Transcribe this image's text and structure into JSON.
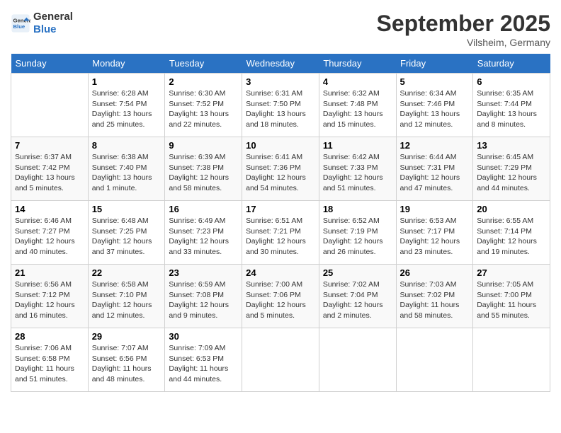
{
  "header": {
    "logo_line1": "General",
    "logo_line2": "Blue",
    "month_title": "September 2025",
    "location": "Vilsheim, Germany"
  },
  "days_of_week": [
    "Sunday",
    "Monday",
    "Tuesday",
    "Wednesday",
    "Thursday",
    "Friday",
    "Saturday"
  ],
  "weeks": [
    [
      {
        "day": "",
        "info": ""
      },
      {
        "day": "1",
        "info": "Sunrise: 6:28 AM\nSunset: 7:54 PM\nDaylight: 13 hours and 25 minutes."
      },
      {
        "day": "2",
        "info": "Sunrise: 6:30 AM\nSunset: 7:52 PM\nDaylight: 13 hours and 22 minutes."
      },
      {
        "day": "3",
        "info": "Sunrise: 6:31 AM\nSunset: 7:50 PM\nDaylight: 13 hours and 18 minutes."
      },
      {
        "day": "4",
        "info": "Sunrise: 6:32 AM\nSunset: 7:48 PM\nDaylight: 13 hours and 15 minutes."
      },
      {
        "day": "5",
        "info": "Sunrise: 6:34 AM\nSunset: 7:46 PM\nDaylight: 13 hours and 12 minutes."
      },
      {
        "day": "6",
        "info": "Sunrise: 6:35 AM\nSunset: 7:44 PM\nDaylight: 13 hours and 8 minutes."
      }
    ],
    [
      {
        "day": "7",
        "info": "Sunrise: 6:37 AM\nSunset: 7:42 PM\nDaylight: 13 hours and 5 minutes."
      },
      {
        "day": "8",
        "info": "Sunrise: 6:38 AM\nSunset: 7:40 PM\nDaylight: 13 hours and 1 minute."
      },
      {
        "day": "9",
        "info": "Sunrise: 6:39 AM\nSunset: 7:38 PM\nDaylight: 12 hours and 58 minutes."
      },
      {
        "day": "10",
        "info": "Sunrise: 6:41 AM\nSunset: 7:36 PM\nDaylight: 12 hours and 54 minutes."
      },
      {
        "day": "11",
        "info": "Sunrise: 6:42 AM\nSunset: 7:33 PM\nDaylight: 12 hours and 51 minutes."
      },
      {
        "day": "12",
        "info": "Sunrise: 6:44 AM\nSunset: 7:31 PM\nDaylight: 12 hours and 47 minutes."
      },
      {
        "day": "13",
        "info": "Sunrise: 6:45 AM\nSunset: 7:29 PM\nDaylight: 12 hours and 44 minutes."
      }
    ],
    [
      {
        "day": "14",
        "info": "Sunrise: 6:46 AM\nSunset: 7:27 PM\nDaylight: 12 hours and 40 minutes."
      },
      {
        "day": "15",
        "info": "Sunrise: 6:48 AM\nSunset: 7:25 PM\nDaylight: 12 hours and 37 minutes."
      },
      {
        "day": "16",
        "info": "Sunrise: 6:49 AM\nSunset: 7:23 PM\nDaylight: 12 hours and 33 minutes."
      },
      {
        "day": "17",
        "info": "Sunrise: 6:51 AM\nSunset: 7:21 PM\nDaylight: 12 hours and 30 minutes."
      },
      {
        "day": "18",
        "info": "Sunrise: 6:52 AM\nSunset: 7:19 PM\nDaylight: 12 hours and 26 minutes."
      },
      {
        "day": "19",
        "info": "Sunrise: 6:53 AM\nSunset: 7:17 PM\nDaylight: 12 hours and 23 minutes."
      },
      {
        "day": "20",
        "info": "Sunrise: 6:55 AM\nSunset: 7:14 PM\nDaylight: 12 hours and 19 minutes."
      }
    ],
    [
      {
        "day": "21",
        "info": "Sunrise: 6:56 AM\nSunset: 7:12 PM\nDaylight: 12 hours and 16 minutes."
      },
      {
        "day": "22",
        "info": "Sunrise: 6:58 AM\nSunset: 7:10 PM\nDaylight: 12 hours and 12 minutes."
      },
      {
        "day": "23",
        "info": "Sunrise: 6:59 AM\nSunset: 7:08 PM\nDaylight: 12 hours and 9 minutes."
      },
      {
        "day": "24",
        "info": "Sunrise: 7:00 AM\nSunset: 7:06 PM\nDaylight: 12 hours and 5 minutes."
      },
      {
        "day": "25",
        "info": "Sunrise: 7:02 AM\nSunset: 7:04 PM\nDaylight: 12 hours and 2 minutes."
      },
      {
        "day": "26",
        "info": "Sunrise: 7:03 AM\nSunset: 7:02 PM\nDaylight: 11 hours and 58 minutes."
      },
      {
        "day": "27",
        "info": "Sunrise: 7:05 AM\nSunset: 7:00 PM\nDaylight: 11 hours and 55 minutes."
      }
    ],
    [
      {
        "day": "28",
        "info": "Sunrise: 7:06 AM\nSunset: 6:58 PM\nDaylight: 11 hours and 51 minutes."
      },
      {
        "day": "29",
        "info": "Sunrise: 7:07 AM\nSunset: 6:56 PM\nDaylight: 11 hours and 48 minutes."
      },
      {
        "day": "30",
        "info": "Sunrise: 7:09 AM\nSunset: 6:53 PM\nDaylight: 11 hours and 44 minutes."
      },
      {
        "day": "",
        "info": ""
      },
      {
        "day": "",
        "info": ""
      },
      {
        "day": "",
        "info": ""
      },
      {
        "day": "",
        "info": ""
      }
    ]
  ]
}
